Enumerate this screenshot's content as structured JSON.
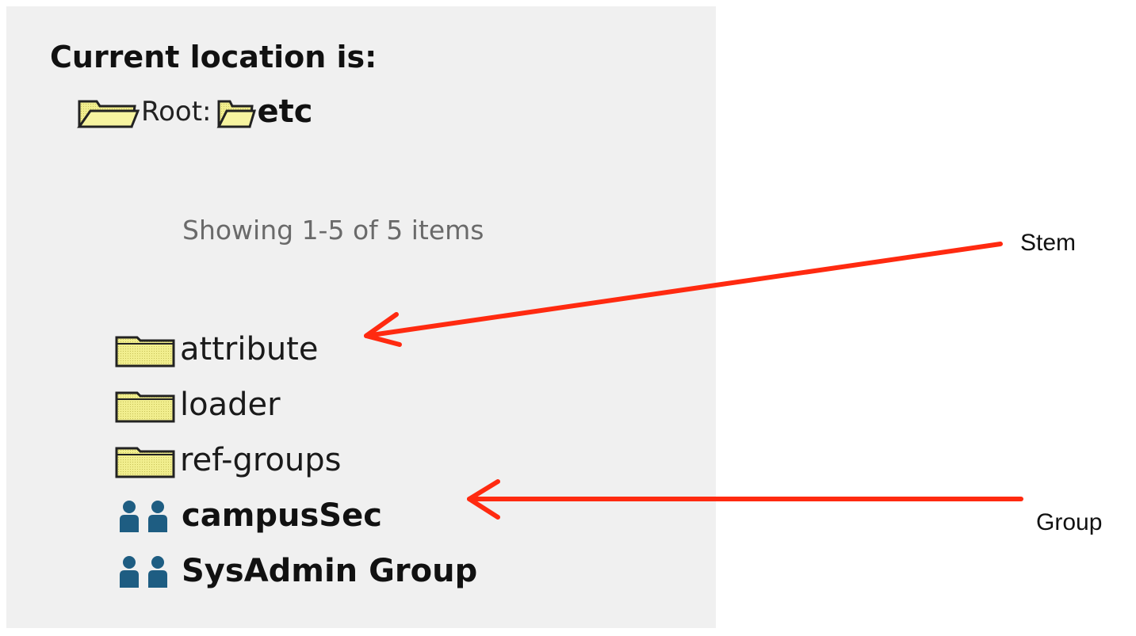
{
  "location": {
    "heading": "Current location is:",
    "breadcrumb": [
      {
        "label": "Root:",
        "icon": "open-folder-icon"
      },
      {
        "label": "etc",
        "icon": "open-folder-icon",
        "current": true
      }
    ]
  },
  "showing_text": "Showing 1-5 of 5 items",
  "items": [
    {
      "label": "attribute",
      "type": "stem",
      "icon": "folder-icon"
    },
    {
      "label": "loader",
      "type": "stem",
      "icon": "folder-icon"
    },
    {
      "label": "ref-groups",
      "type": "stem",
      "icon": "folder-icon"
    },
    {
      "label": "campusSec",
      "type": "group",
      "icon": "group-icon"
    },
    {
      "label": "SysAdmin Group",
      "type": "group",
      "icon": "group-icon"
    }
  ],
  "annotations": {
    "stem_label": "Stem",
    "group_label": "Group",
    "arrow_color": "#ff2a10"
  },
  "colors": {
    "panel_bg": "#f0f0f0",
    "folder_yellow": "#eeec86",
    "group_blue": "#1e5d82"
  }
}
